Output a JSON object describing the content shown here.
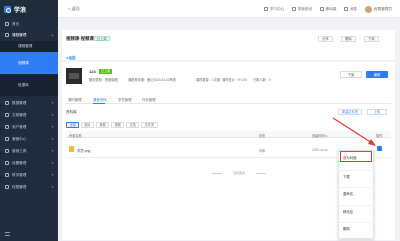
{
  "app": {
    "logo_text": "学浪"
  },
  "sidebar": {
    "items": [
      {
        "label": "首页",
        "icon": "home-icon"
      },
      {
        "label": "课程管理",
        "icon": "book-icon"
      },
      {
        "label": "数据管理",
        "icon": "chart-icon"
      },
      {
        "label": "交易管理",
        "icon": "cart-icon"
      },
      {
        "label": "用户管理",
        "icon": "user-icon"
      },
      {
        "label": "营销中心",
        "icon": "gift-icon"
      },
      {
        "label": "营销工具",
        "icon": "tool-icon"
      },
      {
        "label": "设置管理",
        "icon": "gear-icon"
      },
      {
        "label": "财务管理",
        "icon": "wallet-icon"
      },
      {
        "label": "权限管理",
        "icon": "key-icon"
      }
    ],
    "subitems": [
      "课程管理",
      "视频课",
      "班课库"
    ]
  },
  "topbar": {
    "back": "< 返回",
    "links": [
      "学习中心",
      "学浪资讯",
      "移动端",
      "消息"
    ],
    "username": "权限管理员"
  },
  "header": {
    "title": "视频课·视频课",
    "status": "已上架",
    "buttons": [
      "分享",
      "删除",
      "下架"
    ]
  },
  "breadcrumb": "◂ 返回",
  "course": {
    "id": "123",
    "tag": "已上架",
    "meta": [
      "服务类型：视频课程",
      "课程有效期：截止2020-11-02有效",
      "课时数量：1次课",
      "课时售价：¥ 0.00",
      "已报人数：0"
    ],
    "buttons": [
      "下架",
      "编辑"
    ]
  },
  "tabs": [
    "课时管理",
    "课程资料",
    "学员管理",
    "作业管理"
  ],
  "section": {
    "title": "资料库",
    "buttons": [
      "新建文件夹",
      "上传"
    ]
  },
  "filters": [
    "全部",
    "图片",
    "音频",
    "视频",
    "文档",
    "文件夹"
  ],
  "table": {
    "headers": [
      "资源名称",
      "状态",
      "创建时间 ≡",
      "操作"
    ],
    "rows": [
      {
        "name": "学员.png",
        "status": "待审",
        "time": "2020-xx-xx"
      }
    ]
  },
  "list_end": "没有更多",
  "context_menu": {
    "items": [
      "设为封面",
      "下载",
      "重命名",
      "移动至",
      "删除"
    ]
  },
  "colors": {
    "accent": "#2f7cf6",
    "sidebar": "#1f2d3d",
    "annotation": "#e53935"
  }
}
